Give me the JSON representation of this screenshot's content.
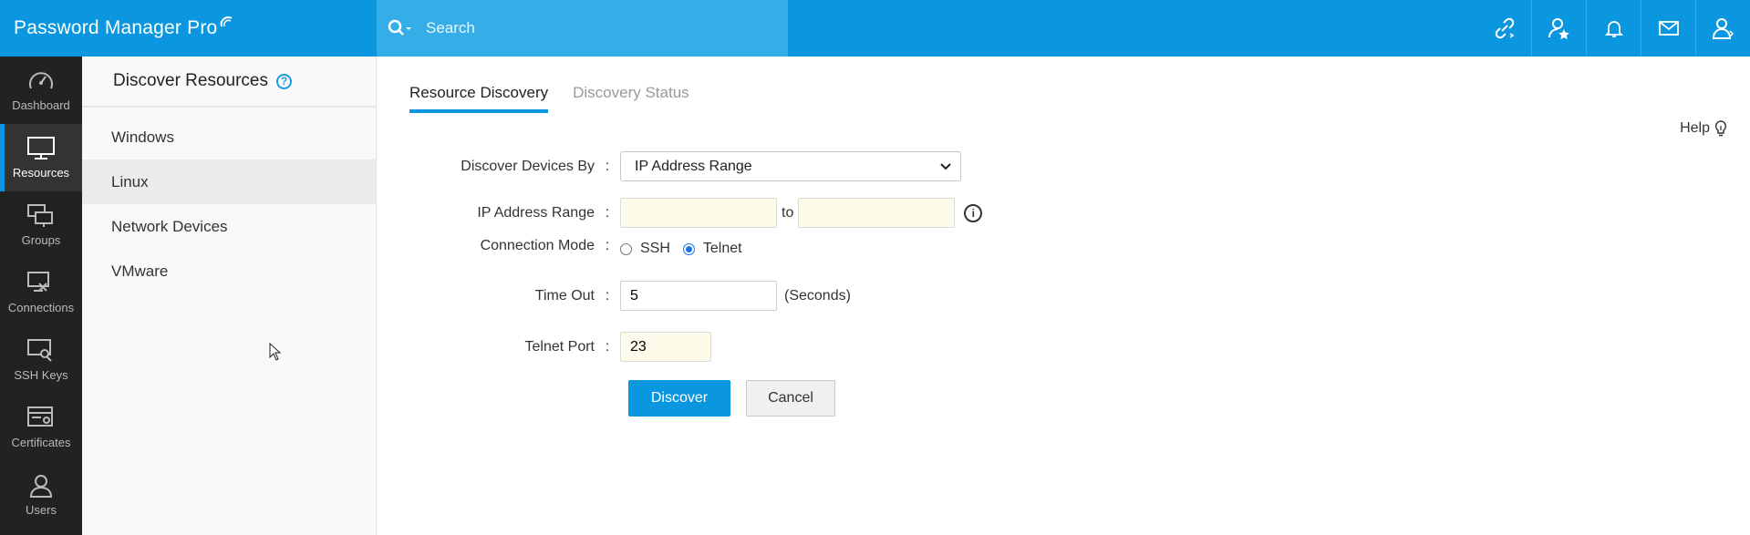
{
  "app": {
    "brand": "Password Manager Pro",
    "accent_color": "#0a97e0"
  },
  "search": {
    "placeholder": "Search"
  },
  "top_icons": [
    "link-icon",
    "user-star-icon",
    "bell-icon",
    "mail-icon",
    "user-icon"
  ],
  "leftnav": {
    "items": [
      {
        "label": "Dashboard",
        "icon": "dashboard-icon"
      },
      {
        "label": "Resources",
        "icon": "monitor-icon"
      },
      {
        "label": "Groups",
        "icon": "groups-icon"
      },
      {
        "label": "Connections",
        "icon": "connections-icon"
      },
      {
        "label": "SSH Keys",
        "icon": "ssh-key-icon"
      },
      {
        "label": "Certificates",
        "icon": "certificate-icon"
      },
      {
        "label": "Users",
        "icon": "users-icon"
      }
    ],
    "active_index": 1
  },
  "subpanel": {
    "title": "Discover Resources",
    "help_glyph": "?",
    "items": [
      "Windows",
      "Linux",
      "Network Devices",
      "VMware"
    ],
    "selected_index": 1
  },
  "main": {
    "tabs": [
      "Resource Discovery",
      "Discovery Status"
    ],
    "active_tab": 0,
    "help_label": "Help",
    "form": {
      "colon": ":",
      "discover_by_label": "Discover Devices By",
      "discover_by_value": "IP Address Range",
      "ip_range_label": "IP Address Range",
      "ip_from_value": "",
      "ip_to_word": "to",
      "ip_to_value": "",
      "info_glyph": "i",
      "connection_mode_label": "Connection Mode",
      "mode_options": [
        "SSH",
        "Telnet"
      ],
      "mode_selected": "Telnet",
      "timeout_label": "Time Out",
      "timeout_value": "5",
      "timeout_unit": "(Seconds)",
      "telnet_port_label": "Telnet Port",
      "telnet_port_value": "23",
      "discover_button": "Discover",
      "cancel_button": "Cancel"
    }
  }
}
